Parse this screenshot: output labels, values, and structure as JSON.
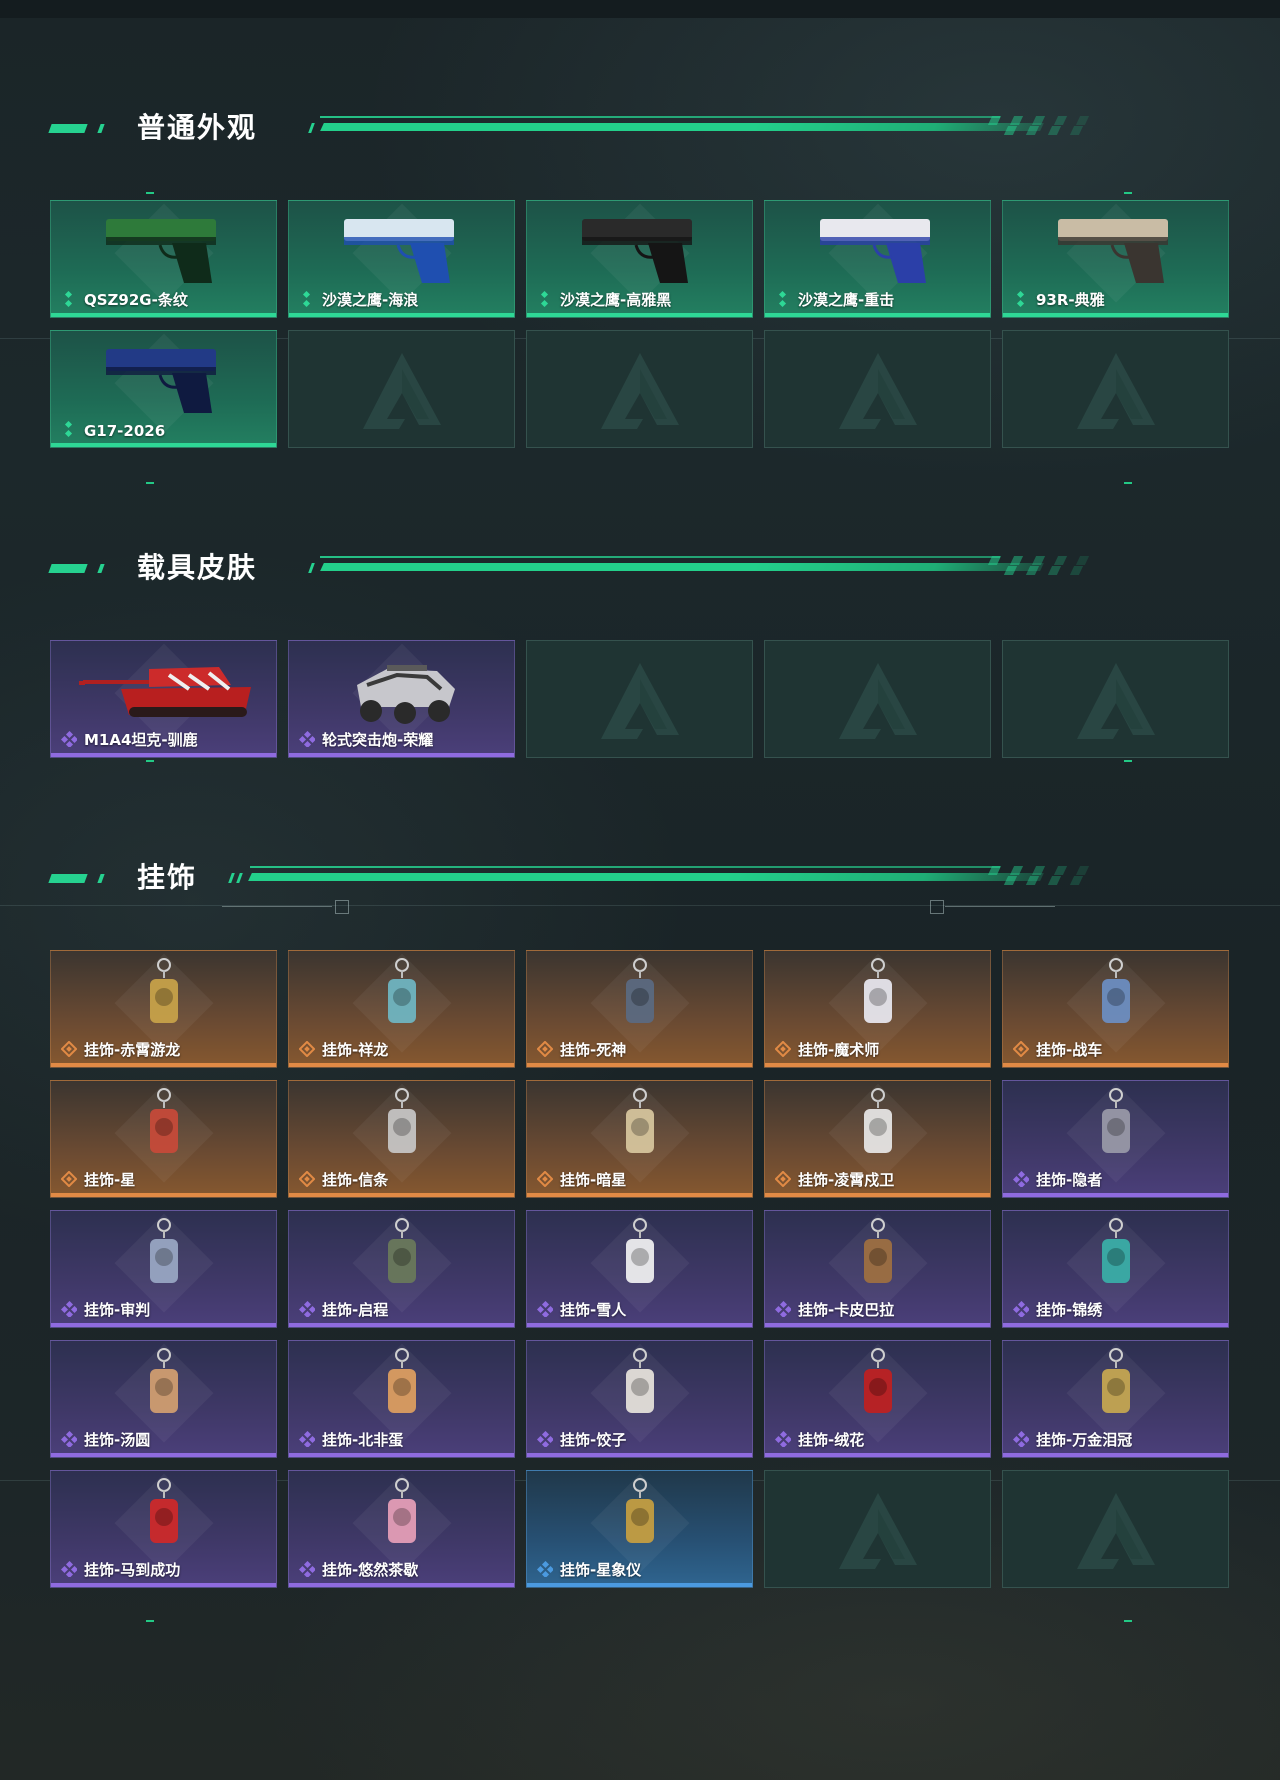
{
  "sections": [
    {
      "title": "普通外观",
      "rarity": "green",
      "items": [
        {
          "label": "QSZ92G-条纹",
          "art": "pistol-green"
        },
        {
          "label": "沙漠之鹰-海浪",
          "art": "deagle-blue"
        },
        {
          "label": "沙漠之鹰-高雅黑",
          "art": "deagle-black"
        },
        {
          "label": "沙漠之鹰-重击",
          "art": "deagle-white"
        },
        {
          "label": "93R-典雅",
          "art": "pistol-tan"
        },
        {
          "label": "G17-2026",
          "art": "pistol-navy"
        },
        {
          "label": "",
          "art": "empty"
        },
        {
          "label": "",
          "art": "empty"
        },
        {
          "label": "",
          "art": "empty"
        },
        {
          "label": "",
          "art": "empty"
        }
      ]
    },
    {
      "title": "载具皮肤",
      "rarity": "purple",
      "items": [
        {
          "label": "M1A4坦克-驯鹿",
          "art": "tank"
        },
        {
          "label": "轮式突击炮-荣耀",
          "art": "vehicle"
        },
        {
          "label": "",
          "art": "empty"
        },
        {
          "label": "",
          "art": "empty"
        },
        {
          "label": "",
          "art": "empty"
        }
      ]
    },
    {
      "title": "挂饰",
      "items": [
        {
          "label": "挂饰-赤霄游龙",
          "rarity": "orange"
        },
        {
          "label": "挂饰-祥龙",
          "rarity": "orange"
        },
        {
          "label": "挂饰-死神",
          "rarity": "orange"
        },
        {
          "label": "挂饰-魔术师",
          "rarity": "orange"
        },
        {
          "label": "挂饰-战车",
          "rarity": "orange"
        },
        {
          "label": "挂饰-星",
          "rarity": "orange"
        },
        {
          "label": "挂饰-信条",
          "rarity": "orange"
        },
        {
          "label": "挂饰-暗星",
          "rarity": "orange"
        },
        {
          "label": "挂饰-凌霄戍卫",
          "rarity": "orange"
        },
        {
          "label": "挂饰-隐者",
          "rarity": "purple"
        },
        {
          "label": "挂饰-审判",
          "rarity": "purple"
        },
        {
          "label": "挂饰-启程",
          "rarity": "purple"
        },
        {
          "label": "挂饰-雪人",
          "rarity": "purple"
        },
        {
          "label": "挂饰-卡皮巴拉",
          "rarity": "purple"
        },
        {
          "label": "挂饰-锦绣",
          "rarity": "purple"
        },
        {
          "label": "挂饰-汤圆",
          "rarity": "purple"
        },
        {
          "label": "挂饰-北非蛋",
          "rarity": "purple"
        },
        {
          "label": "挂饰-饺子",
          "rarity": "purple"
        },
        {
          "label": "挂饰-绒花",
          "rarity": "purple"
        },
        {
          "label": "挂饰-万金泪冠",
          "rarity": "purple"
        },
        {
          "label": "挂饰-马到成功",
          "rarity": "purple"
        },
        {
          "label": "挂饰-悠然茶歇",
          "rarity": "purple"
        },
        {
          "label": "挂饰-星象仪",
          "rarity": "blue"
        },
        {
          "label": "",
          "rarity": "empty"
        },
        {
          "label": "",
          "rarity": "empty"
        }
      ]
    }
  ],
  "colors": {
    "accent": "#26d290",
    "green": "#2ed896",
    "purple": "#8f6be0",
    "orange": "#e18a45",
    "blue": "#4b9ae0"
  }
}
